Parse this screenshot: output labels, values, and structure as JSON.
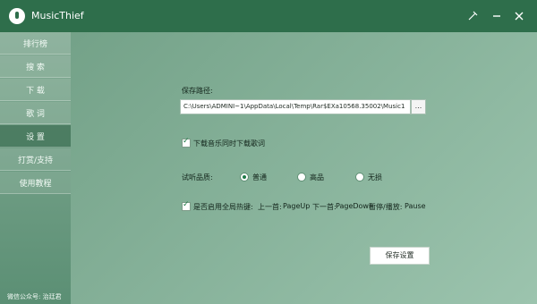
{
  "window": {
    "title": "MusicThief"
  },
  "sidebar": {
    "items": [
      {
        "label": "排行榜",
        "active": false
      },
      {
        "label": "搜 索",
        "active": false
      },
      {
        "label": "下 载",
        "active": false
      },
      {
        "label": "歌 词",
        "active": false
      },
      {
        "label": "设 置",
        "active": true
      },
      {
        "label": "打赏/支持",
        "active": false
      },
      {
        "label": "使用教程",
        "active": false
      }
    ],
    "footer": "微信公众号: 治廷君"
  },
  "settings": {
    "save_path_label": "保存路径:",
    "save_path_value": "C:\\Users\\ADMINI~1\\AppData\\Local\\Temp\\Rar$EXa10568.35002\\Music1",
    "browse_label": "...",
    "download_lyrics_label": "下载音乐同时下载歌词",
    "download_lyrics_checked": true,
    "quality_label": "试听品质:",
    "quality_options": [
      "普通",
      "高品",
      "无损"
    ],
    "quality_selected": "普通",
    "hotkeys_label": "是否启用全局热键:",
    "hotkeys_checked": true,
    "hotkeys": [
      {
        "label": "上一首:",
        "key": "PageUp"
      },
      {
        "label": "下一首:",
        "key": "PageDown"
      },
      {
        "label": "暂停/播放:",
        "key": "Pause"
      }
    ],
    "save_button_label": "保存设置"
  },
  "colors": {
    "titlebar": "#2e6e4b",
    "sidebar_active": "#2c6044",
    "accent": "#1f7a47"
  }
}
